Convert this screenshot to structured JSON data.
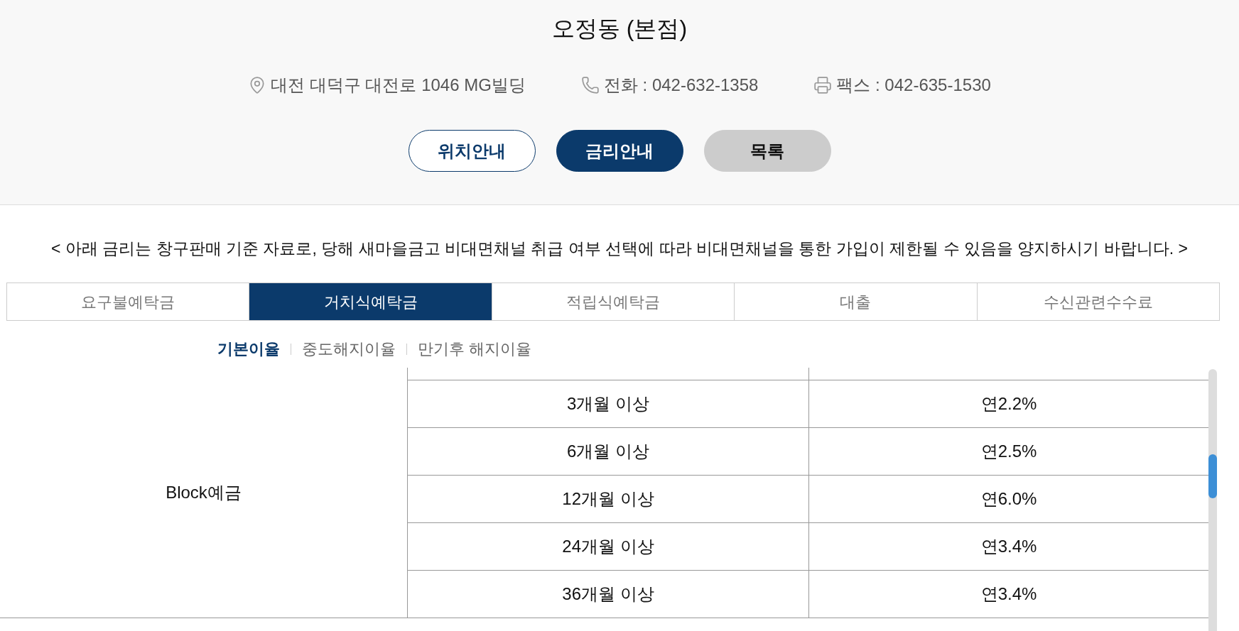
{
  "header": {
    "title": "오정동 (본점)",
    "info": [
      {
        "kind": "address",
        "text": "대전 대덕구 대전로 1046 MG빌딩"
      },
      {
        "kind": "phone",
        "text": "전화 : 042-632-1358"
      },
      {
        "kind": "fax",
        "text": "팩스 : 042-635-1530"
      }
    ],
    "buttons": [
      {
        "label": "위치안내",
        "kind": "outline"
      },
      {
        "label": "금리안내",
        "kind": "filled"
      },
      {
        "label": "목록",
        "kind": "gray"
      }
    ]
  },
  "notice": "< 아래 금리는 창구판매 기준 자료로, 당해 새마을금고 비대면채널 취급 여부 선택에 따라 비대면채널을 통한 가입이 제한될 수 있음을 양지하시기 바랍니다. >",
  "tabs": [
    {
      "label": "요구불예탁금",
      "selected": false
    },
    {
      "label": "거치식예탁금",
      "selected": true
    },
    {
      "label": "적립식예탁금",
      "selected": false
    },
    {
      "label": "대출",
      "selected": false
    },
    {
      "label": "수신관련수수료",
      "selected": false
    }
  ],
  "subtabs": [
    {
      "label": "기본이율",
      "selected": true
    },
    {
      "label": "중도해지이율",
      "selected": false
    },
    {
      "label": "만기후 해지이율",
      "selected": false
    }
  ],
  "table": {
    "rows": [
      {
        "product": "Block예금",
        "terms": [
          {
            "period": "3개월 이상",
            "rate": "연2.2%"
          },
          {
            "period": "6개월 이상",
            "rate": "연2.5%"
          },
          {
            "period": "12개월 이상",
            "rate": "연6.0%"
          },
          {
            "period": "24개월 이상",
            "rate": "연3.4%"
          },
          {
            "period": "36개월 이상",
            "rate": "연3.4%"
          }
        ]
      }
    ]
  }
}
